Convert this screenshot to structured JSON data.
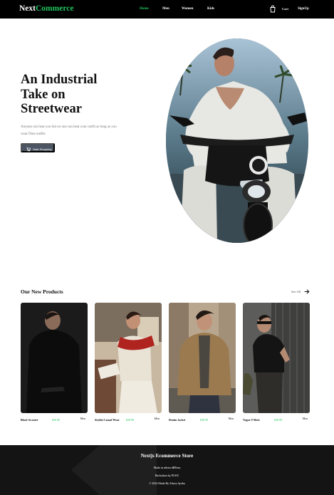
{
  "nav": {
    "logo_primary": "Next",
    "logo_accent": "Commerce",
    "links": [
      "Home",
      "Men",
      "Women",
      "Kids"
    ],
    "cart_label": "Cart",
    "signup_label": "SignUp",
    "accent_color": "#22c55e"
  },
  "hero": {
    "title": "An Industrial Take on Streetwear",
    "description": "Anyone can beat you but no one can beat your outfit as long as you wear Dine outfits",
    "button_label": "Start Shopping",
    "button_icon": "cart-icon"
  },
  "products": {
    "section_title": "Our New Products",
    "see_all_label": "See All",
    "items": [
      {
        "name": "Black Sweater",
        "price": "$39.99",
        "category": "Men"
      },
      {
        "name": "Stylish Casual Wear",
        "price": "$39.99",
        "category": "Men"
      },
      {
        "name": "Denim Jacket",
        "price": "$39.99",
        "category": "Men"
      },
      {
        "name": "Vogue T-Shirt",
        "price": "$39.99",
        "category": "Men"
      }
    ]
  },
  "footer": {
    "title": "Nextjs Ecommerce Store",
    "line1": "Made in nSeen dBPoen",
    "line2": "Hackathon by PIAIC",
    "line3": "© 2024 Made By Alizey Ayoba"
  }
}
